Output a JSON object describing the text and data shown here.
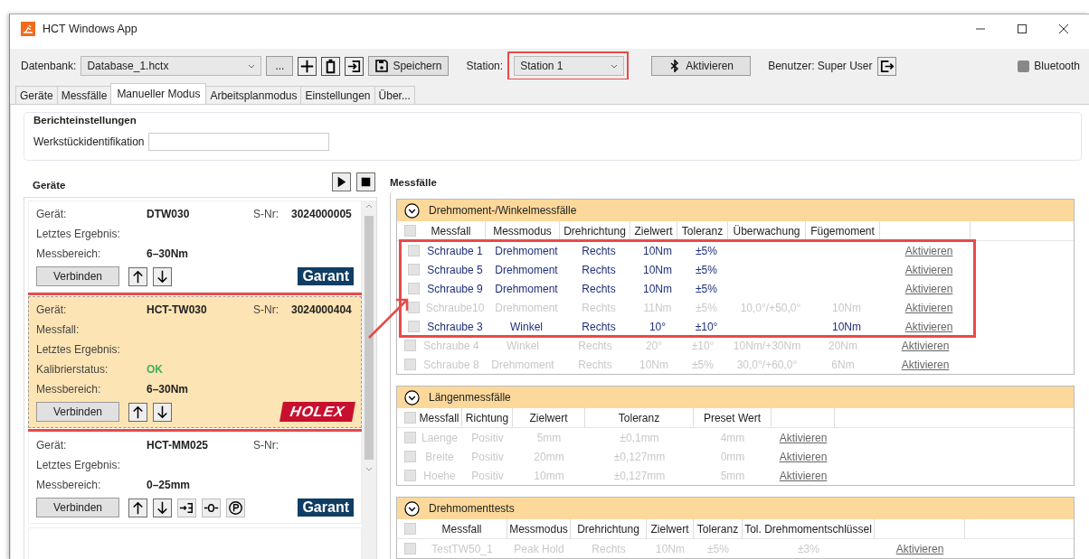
{
  "window": {
    "title": "HCT Windows App"
  },
  "toolbar": {
    "database_label": "Datenbank:",
    "database": "Database_1.hctx",
    "browse": "...",
    "save": "Speichern",
    "station_label": "Station:",
    "station": "Station 1",
    "station_highlighted": true,
    "activate": "Aktivieren",
    "user": "Benutzer: Super User",
    "bluetooth": "Bluetooth",
    "bluetooth_checked": false
  },
  "tabs": [
    {
      "label": "Geräte",
      "selected": false
    },
    {
      "label": "Messfälle",
      "selected": false
    },
    {
      "label": "Manueller Modus",
      "selected": true
    },
    {
      "label": "Arbeitsplanmodus",
      "selected": false
    },
    {
      "label": "Einstellungen",
      "selected": false
    },
    {
      "label": "Über...",
      "selected": false
    }
  ],
  "report": {
    "title": "Berichteinstellungen",
    "field_label": "Werkstückidentifikation"
  },
  "devices": {
    "title": "Geräte",
    "items": [
      {
        "name_label": "Gerät:",
        "name": "DTW030",
        "serial_label": "S-Nr:",
        "serial": "3024000005",
        "fields": [
          {
            "label": "Letztes Ergebnis:"
          },
          {
            "label": "Messbereich:",
            "value": "6–30Nm",
            "kind": "text"
          }
        ],
        "connect": "Verbinden",
        "brand": {
          "text": "Garant",
          "kind": "plain",
          "color": "#0f3d63"
        },
        "selected": false,
        "highlighted": false,
        "extra_tools": false
      },
      {
        "name_label": "Gerät:",
        "name": "HCT-TW030",
        "serial_label": "S-Nr:",
        "serial": "3024000404",
        "fields": [
          {
            "label": "Messfall:"
          },
          {
            "label": "Letztes Ergebnis:"
          },
          {
            "label": "Kalibrierstatus:",
            "value": "OK",
            "kind": "status"
          },
          {
            "label": "Messbereich:",
            "value": "6–30Nm",
            "kind": "text"
          }
        ],
        "connect": "Verbinden",
        "brand": {
          "text": "HOLEX",
          "kind": "slanted",
          "color": "#c8102e"
        },
        "selected": true,
        "highlighted": true,
        "extra_tools": false
      },
      {
        "name_label": "Gerät:",
        "name": "HCT-MM025",
        "serial_label": "S-Nr:",
        "fields": [
          {
            "label": "Letztes Ergebnis:"
          },
          {
            "label": "Messbereich:",
            "value": "0–25mm",
            "kind": "text"
          }
        ],
        "connect": "Verbinden",
        "brand": {
          "text": "Garant",
          "kind": "plain",
          "color": "#0f3d63"
        },
        "selected": false,
        "highlighted": false,
        "extra_tools": true
      }
    ]
  },
  "cases": {
    "title": "Messfälle",
    "sections": [
      {
        "title": "Drehmoment-/Winkelmessfälle",
        "all_checked": false,
        "columns": [
          "Messfall",
          "Messmodus",
          "Drehrichtung",
          "Zielwert",
          "Toleranz",
          "Überwachung",
          "Fügemoment"
        ],
        "rows": [
          {
            "cells": [
              "Schraube 1",
              "Drehmoment",
              "Rechts",
              "10Nm",
              "±5%",
              "",
              ""
            ],
            "link": "Aktivieren",
            "disabled": false,
            "highlighted": true
          },
          {
            "cells": [
              "Schraube 5",
              "Drehmoment",
              "Rechts",
              "10Nm",
              "±5%",
              "",
              ""
            ],
            "link": "Aktivieren",
            "disabled": false,
            "highlighted": true
          },
          {
            "cells": [
              "Schraube 9",
              "Drehmoment",
              "Rechts",
              "10Nm",
              "±5%",
              "",
              ""
            ],
            "link": "Aktivieren",
            "disabled": false,
            "highlighted": true
          },
          {
            "cells": [
              "Schraube10",
              "Drehmoment",
              "Rechts",
              "11Nm",
              "±5%",
              "10,0°/+50,0°",
              "10Nm"
            ],
            "link": "Aktivieren",
            "disabled": true,
            "highlighted": true
          },
          {
            "cells": [
              "Schraube 3",
              "Winkel",
              "Rechts",
              "10°",
              "±10°",
              "",
              "10Nm"
            ],
            "link": "Aktivieren",
            "disabled": false,
            "highlighted": true
          },
          {
            "cells": [
              "Schraube 4",
              "Winkel",
              "Rechts",
              "20°",
              "±10°",
              "10Nm/+30Nm",
              "20Nm"
            ],
            "link": "Aktivieren",
            "disabled": true,
            "highlighted": false
          },
          {
            "cells": [
              "Schraube 8",
              "Drehmoment",
              "Rechts",
              "10Nm",
              "±5%",
              "30,0°/+60,0°",
              "6Nm"
            ],
            "link": "Aktivieren",
            "disabled": true,
            "highlighted": false
          }
        ]
      },
      {
        "title": "Längenmessfälle",
        "all_checked": false,
        "columns": [
          "Messfall",
          "Richtung",
          "Zielwert",
          "Toleranz",
          "Preset Wert"
        ],
        "rows": [
          {
            "cells": [
              "Laenge",
              "Positiv",
              "5mm",
              "±0,1mm",
              "4mm"
            ],
            "link": "Aktivieren",
            "disabled": true,
            "highlighted": false
          },
          {
            "cells": [
              "Breite",
              "Positiv",
              "20mm",
              "±0,127mm",
              "0mm"
            ],
            "link": "Aktivieren",
            "disabled": true,
            "highlighted": false
          },
          {
            "cells": [
              "Hoehe",
              "Positiv",
              "10mm",
              "±0,127mm",
              "5mm"
            ],
            "link": "Aktivieren",
            "disabled": true,
            "highlighted": false
          }
        ]
      },
      {
        "title": "Drehmomenttests",
        "all_checked": false,
        "columns": [
          "Messfall",
          "Messmodus",
          "Drehrichtung",
          "Zielwert",
          "Toleranz",
          "Tol. Drehmomentschlüssel"
        ],
        "rows": [
          {
            "cells": [
              "TestTW50_1",
              "Peak Hold",
              "Rechts",
              "10Nm",
              "±5%",
              "±3%"
            ],
            "link": "Aktivieren",
            "disabled": true,
            "highlighted": false
          }
        ]
      }
    ]
  }
}
